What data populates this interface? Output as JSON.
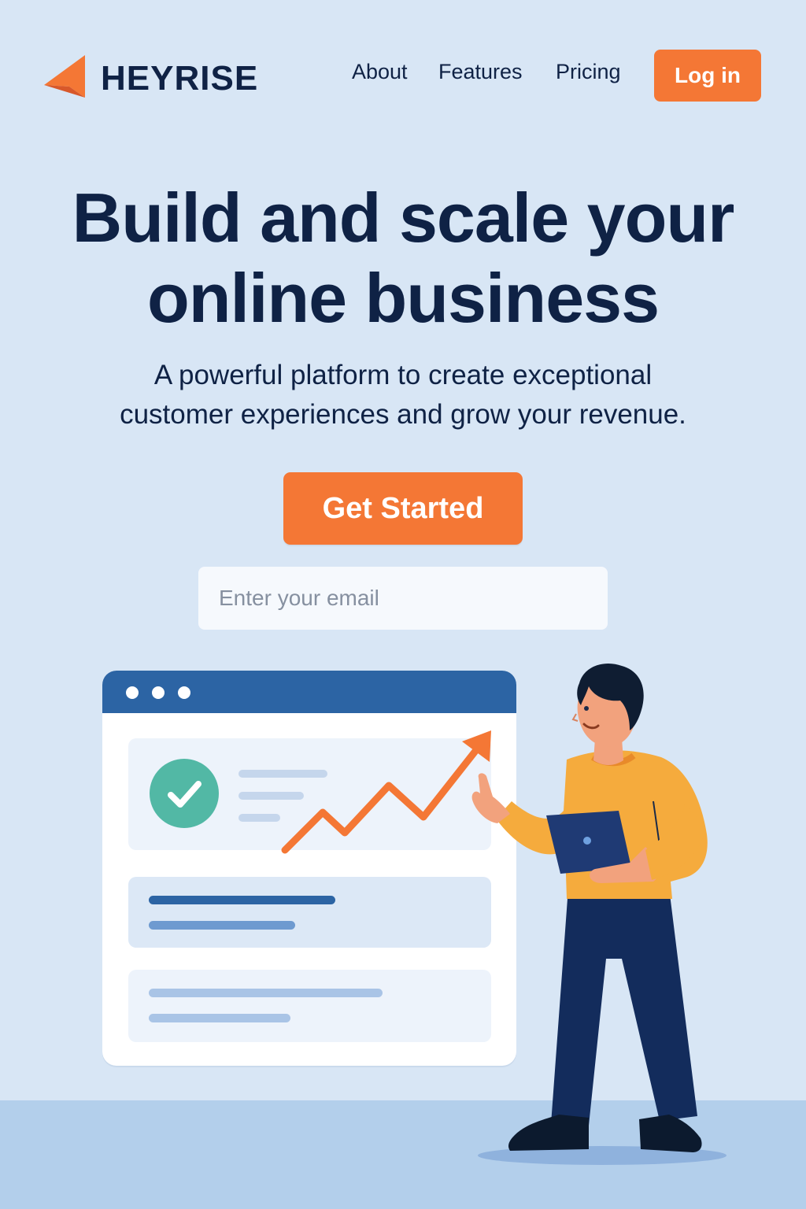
{
  "header": {
    "brand": "HEYRISE",
    "nav": {
      "about": "About",
      "features": "Features",
      "pricing": "Pricing"
    },
    "login_label": "Log in"
  },
  "hero": {
    "headline_line1": "Build and scale your",
    "headline_line2": "online business",
    "subline_line1": "A powerful platform to create exceptional",
    "subline_line2": "customer experiences and grow your revenue.",
    "cta_label": "Get Started",
    "email_placeholder": "Enter your email"
  },
  "illustration": {
    "icons": [
      "logo-arrow-icon",
      "check-icon",
      "trend-arrow-icon",
      "laptop-icon"
    ]
  },
  "colors": {
    "accent": "#f47735",
    "background": "#d8e6f5",
    "text": "#0f2245",
    "browser_bar": "#2c64a4",
    "check_green": "#52b8a5"
  }
}
